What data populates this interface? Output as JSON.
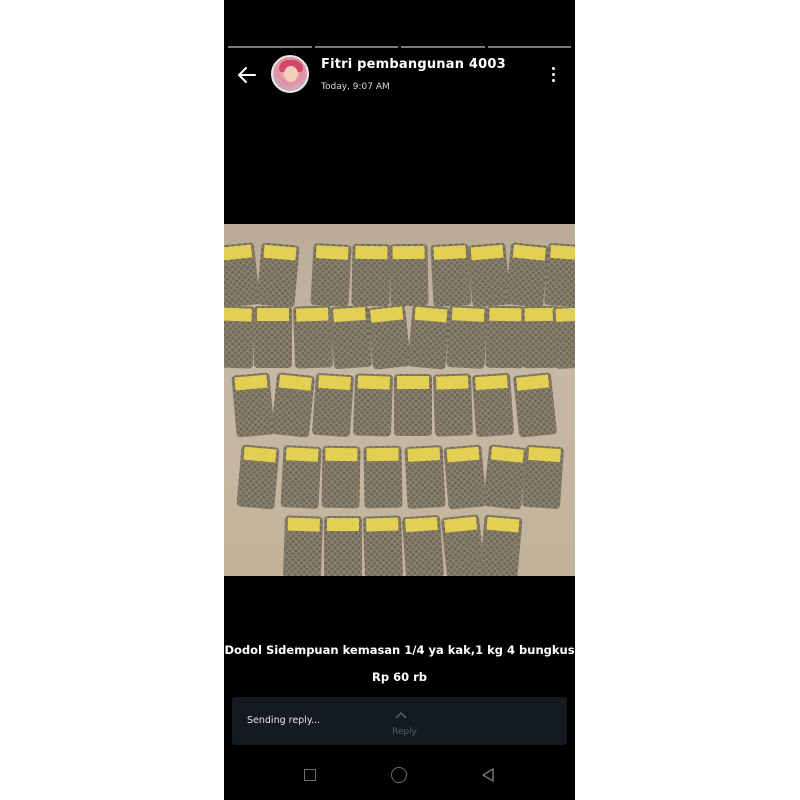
{
  "story": {
    "progress_segments": 4,
    "user_name": "Fitri pembangunan 4003",
    "timestamp": "Today, 9:07 AM",
    "caption_line1": "Dodol Sidempuan kemasan 1/4 ya kak,1 kg 4 bungkus",
    "caption_line2": "Rp 60 rb"
  },
  "reply": {
    "status_text": "Sending reply...",
    "label": "Reply"
  },
  "icons": {
    "back": "arrow-left-icon",
    "menu": "kebab-menu-icon",
    "reply": "chevron-up-icon",
    "nav_recents": "square-icon",
    "nav_home": "circle-icon",
    "nav_back": "triangle-back-icon"
  },
  "colors": {
    "background": "#000000",
    "reply_bar": "#141a22",
    "text": "#ffffff",
    "nav_icons": "#6e6e6e"
  }
}
